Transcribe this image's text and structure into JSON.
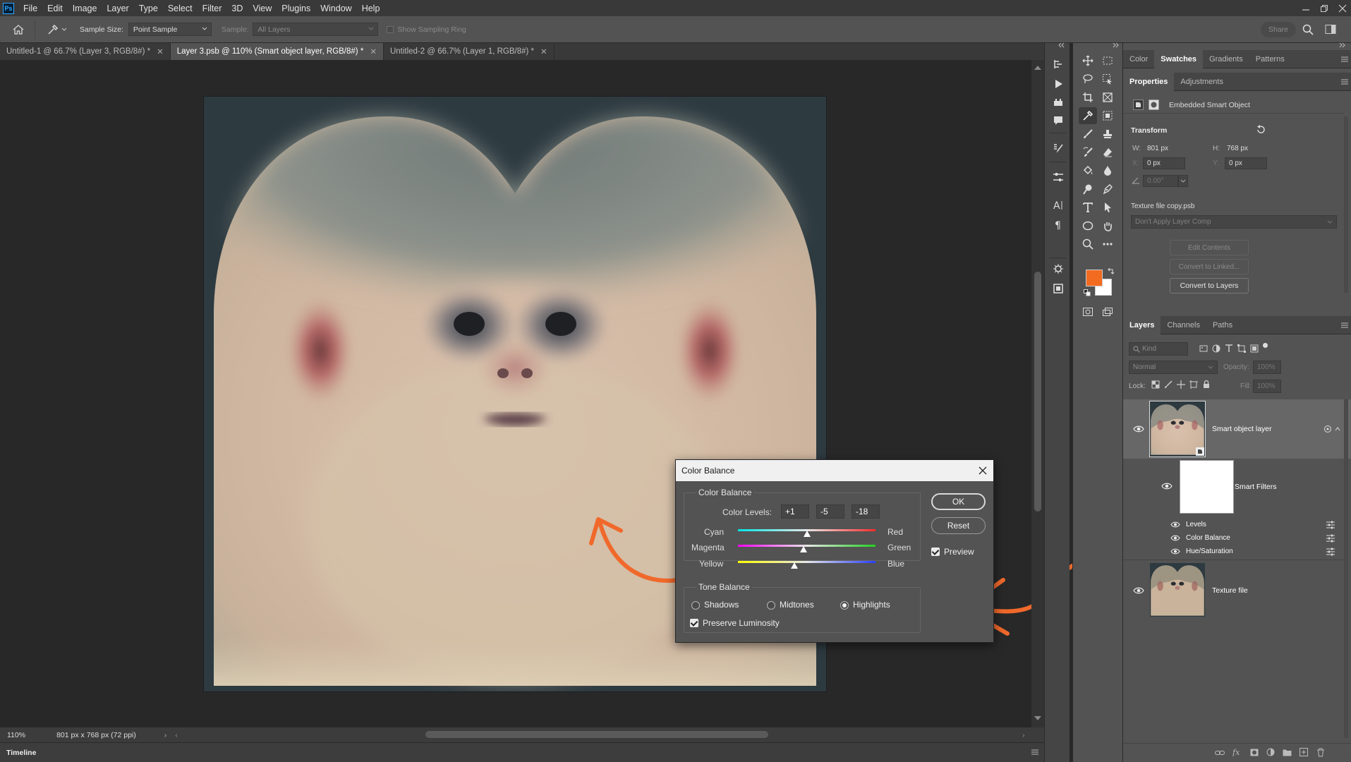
{
  "menubar": {
    "logo": "Ps",
    "items": [
      "File",
      "Edit",
      "Image",
      "Layer",
      "Type",
      "Select",
      "Filter",
      "3D",
      "View",
      "Plugins",
      "Window",
      "Help"
    ]
  },
  "options_bar": {
    "sample_size_label": "Sample Size:",
    "sample_size_value": "Point Sample",
    "sample_label": "Sample:",
    "sample_value": "All Layers",
    "show_ring_label": "Show Sampling Ring",
    "share_label": "Share"
  },
  "tabs": [
    {
      "label": "Untitled-1 @ 66.7% (Layer 3, RGB/8#) *",
      "active": false
    },
    {
      "label": "Layer 3.psb @ 110% (Smart object layer, RGB/8#) *",
      "active": true
    },
    {
      "label": "Untitled-2 @ 66.7% (Layer 1, RGB/8#) *",
      "active": false
    }
  ],
  "status": {
    "zoom": "110%",
    "doc_info": "801 px x 768 px (72 ppi)"
  },
  "timeline": {
    "label": "Timeline"
  },
  "panels": {
    "top_tabs": [
      {
        "label": "Color",
        "active": false
      },
      {
        "label": "Swatches",
        "active": true
      },
      {
        "label": "Gradients",
        "active": false
      },
      {
        "label": "Patterns",
        "active": false
      }
    ],
    "props_tabs": [
      {
        "label": "Properties",
        "active": true
      },
      {
        "label": "Adjustments",
        "active": false
      }
    ],
    "properties": {
      "object_type": "Embedded Smart Object",
      "transform_label": "Transform",
      "w_label": "W:",
      "w_value": "801 px",
      "h_label": "H:",
      "h_value": "768 px",
      "x_label": "X:",
      "x_value": "0 px",
      "y_label": "Y:",
      "y_value": "0 px",
      "angle_value": "0.00°",
      "file_name": "Texture file copy.psb",
      "layer_comp": "Don't Apply Layer Comp",
      "edit_contents": "Edit Contents",
      "convert_linked": "Convert to Linked...",
      "convert_layers": "Convert to Layers"
    },
    "layers_tabs": [
      {
        "label": "Layers",
        "active": true
      },
      {
        "label": "Channels",
        "active": false
      },
      {
        "label": "Paths",
        "active": false
      }
    ],
    "layers": {
      "kind_placeholder": "Kind",
      "blend_mode": "Normal",
      "opacity_label": "Opacity:",
      "opacity_value": "100%",
      "lock_label": "Lock:",
      "fill_label": "Fill:",
      "fill_value": "100%",
      "smart_object_layer": "Smart object layer",
      "smart_filters": "Smart Filters",
      "filters": [
        "Levels",
        "Color Balance",
        "Hue/Saturation"
      ],
      "texture_layer": "Texture file"
    }
  },
  "dialog": {
    "title": "Color Balance",
    "group_color": "Color Balance",
    "color_levels_label": "Color Levels:",
    "levels": [
      "+1",
      "-5",
      "-18"
    ],
    "sliders": [
      {
        "left": "Cyan",
        "right": "Red",
        "value": 1,
        "left_color": "#00e5e5",
        "right_color": "#ff2a2a"
      },
      {
        "left": "Magenta",
        "right": "Green",
        "value": -5,
        "left_color": "#ff00ff",
        "right_color": "#22d122"
      },
      {
        "left": "Yellow",
        "right": "Blue",
        "value": -18,
        "left_color": "#ffff00",
        "right_color": "#2a3cff"
      }
    ],
    "slider_range": [
      -100,
      100
    ],
    "group_tone": "Tone Balance",
    "tone_options": [
      "Shadows",
      "Midtones",
      "Highlights"
    ],
    "tone_selected": "Highlights",
    "preserve_label": "Preserve Luminosity",
    "preserve_checked": true,
    "ok_label": "OK",
    "reset_label": "Reset",
    "preview_label": "Preview",
    "preview_checked": true
  },
  "colors": {
    "foreground": "#f26b21",
    "background": "#ffffff",
    "annotation_arrow": "#f0692b"
  }
}
